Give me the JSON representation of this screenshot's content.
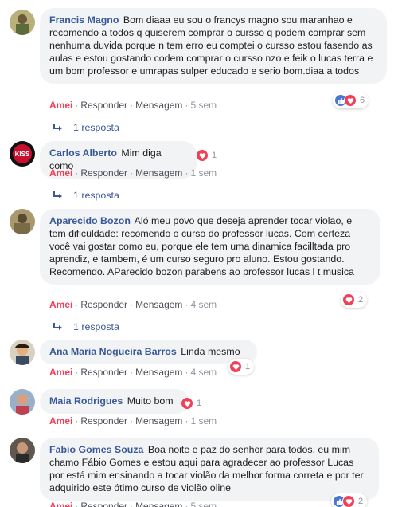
{
  "comments": [
    {
      "author": "Francis Magno",
      "text": "Bom diaaa eu sou o francys magno sou maranhao e recomendo a todos q quiserem comprar o cursso q podem comprar sem nenhuma duvida porque n tem erro eu comptei o cursso estou fasendo as aulas e estou gostando codem comprar o cursso nzo e feik o lucas terra e um bom professor e umrapas sulper educado e serio bom.diaa a todos",
      "amei": "Amei",
      "responder": "Responder",
      "mensagem": "Mensagem",
      "time": "5 sem",
      "reaction_count": "6",
      "reactions": [
        "like",
        "love"
      ],
      "replies": "1 resposta"
    },
    {
      "author": "Carlos Alberto",
      "text": "Mim diga como",
      "amei": "Amei",
      "responder": "Responder",
      "mensagem": "Mensagem",
      "time": "1 sem",
      "reaction_count": "1",
      "reactions": [
        "love"
      ],
      "replies": "1 resposta"
    },
    {
      "author": "Aparecido Bozon",
      "text": "Aló meu povo que deseja aprender tocar violao, e tem dificuldade: recomendo o curso do professor lucas. Com certeza você vai gostar como eu, porque ele tem uma dinamica facilltada pro aprendiz, e tambem, é um curso seguro pro aluno. Estou gostando. Recomendo. AParecido bozon parabens ao professor lucas l t musica",
      "amei": "Amei",
      "responder": "Responder",
      "mensagem": "Mensagem",
      "time": "4 sem",
      "reaction_count": "2",
      "reactions": [
        "love"
      ],
      "replies": "1 resposta"
    },
    {
      "author": "Ana Maria Nogueira Barros",
      "text": "Linda mesmo",
      "amei": "Amei",
      "responder": "Responder",
      "mensagem": "Mensagem",
      "time": "4 sem",
      "reaction_count": "1",
      "reactions": [
        "love"
      ]
    },
    {
      "author": "Maia Rodrigues",
      "text": "Muito bom",
      "amei": "Amei",
      "responder": "Responder",
      "mensagem": "Mensagem",
      "time": "1 sem",
      "reaction_count": "1",
      "reactions": [
        "love"
      ]
    },
    {
      "author": "Fabio Gomes Souza",
      "text": "Boa noite e paz do senhor para todos, eu mim chamo Fábio Gomes e estou aqui para agradecer ao professor Lucas por está mim ensinando a tocar violão da melhor forma correta e por ter adquirido este ótimo curso de violão oline",
      "amei": "Amei",
      "responder": "Responder",
      "mensagem": "Mensagem",
      "time": "5 sem",
      "reaction_count": "2",
      "reactions": [
        "like",
        "love"
      ]
    }
  ],
  "colors": {
    "author": "#385898",
    "amei": "#f33e58",
    "bubble": "#f2f3f5",
    "like": "#4a76d4",
    "love": "#f33e58"
  }
}
